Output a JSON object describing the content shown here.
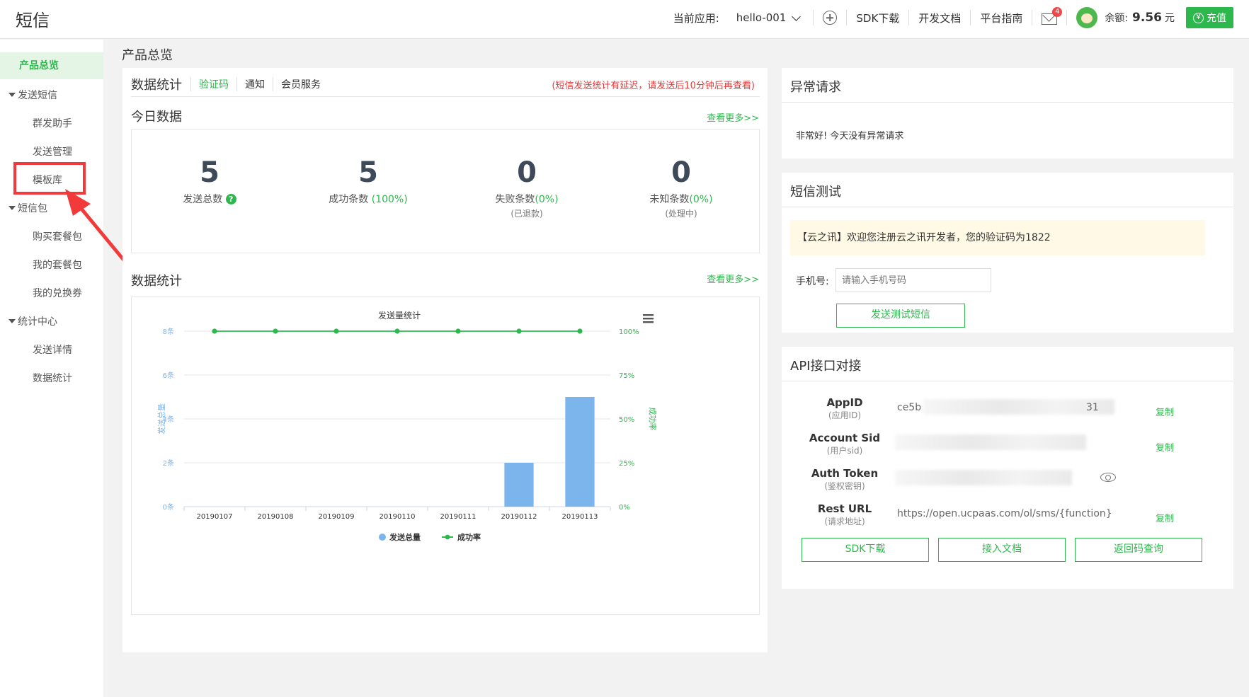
{
  "header": {
    "logo": "短信",
    "current_app_label": "当前应用:",
    "current_app": "hello-001",
    "sdk_download": "SDK下载",
    "dev_docs": "开发文档",
    "platform_guide": "平台指南",
    "mail_count": "4",
    "balance_label": "余额:",
    "balance_value": "9.56",
    "balance_unit": "元",
    "recharge": "充值",
    "recharge_symbol": "¥"
  },
  "sidebar": {
    "active": "产品总览",
    "groups": [
      {
        "label": "发送短信",
        "items": [
          "群发助手",
          "发送管理",
          "模板库"
        ]
      },
      {
        "label": "短信包",
        "items": [
          "购买套餐包",
          "我的套餐包",
          "我的兑换券"
        ]
      },
      {
        "label": "统计中心",
        "items": [
          "发送详情",
          "数据统计"
        ]
      }
    ]
  },
  "main": {
    "page_title": "产品总览",
    "stats_panel": {
      "title": "数据统计",
      "tabs": [
        "验证码",
        "通知",
        "会员服务"
      ],
      "active_tab": "验证码",
      "notice": "(短信发送统计有延迟，请发送后10分钟后再查看)",
      "today_title": "今日数据",
      "more": "查看更多>>",
      "stats": [
        {
          "num": "5",
          "label": "发送总数",
          "extra": "",
          "sub": ""
        },
        {
          "num": "5",
          "label": "成功条数",
          "extra": "(100%)",
          "sub": ""
        },
        {
          "num": "0",
          "label": "失败条数",
          "extra": "(0%)",
          "sub": "(已退款)"
        },
        {
          "num": "0",
          "label": "未知条数",
          "extra": "(0%)",
          "sub": "(处理中)"
        }
      ],
      "help_icon_glyph": "?",
      "chart_section_title": "数据统计",
      "chart_more": "查看更多>>"
    }
  },
  "chart_data": {
    "type": "bar",
    "title": "发送量统计",
    "categories": [
      "20190107",
      "20190108",
      "20190109",
      "20190110",
      "20190111",
      "20190112",
      "20190113"
    ],
    "series": [
      {
        "name": "发送总量",
        "type": "bar",
        "values": [
          0,
          0,
          0,
          0,
          0,
          2,
          5
        ],
        "color": "#7cb5ec"
      },
      {
        "name": "成功率",
        "type": "line",
        "values": [
          100,
          100,
          100,
          100,
          100,
          100,
          100
        ],
        "color": "#2db84d"
      }
    ],
    "ylabel": "发送总量",
    "y2label": "成功率",
    "yticks": [
      "0条",
      "2条",
      "4条",
      "6条",
      "8条"
    ],
    "y2ticks": [
      "0%",
      "25%",
      "50%",
      "75%",
      "100%"
    ],
    "ylim": [
      0,
      8
    ],
    "y2lim": [
      0,
      100
    ],
    "legend": "bottom-center",
    "grid": true
  },
  "right": {
    "abnormal": {
      "title": "异常请求",
      "message": "非常好! 今天没有异常请求"
    },
    "sms_test": {
      "title": "短信测试",
      "preview": "【云之讯】欢迎您注册云之讯开发者，您的验证码为1822",
      "phone_label": "手机号:",
      "phone_placeholder": "请输入手机号码",
      "send_button": "发送测试短信"
    },
    "api": {
      "title": "API接口对接",
      "rows": [
        {
          "key": "AppID",
          "sub": "(应用ID)",
          "value_start": "ce5b",
          "value_end": "31",
          "copy": "复制"
        },
        {
          "key": "Account Sid",
          "sub": "(用户sid)",
          "value_start": "",
          "value_end": "",
          "copy": "复制"
        },
        {
          "key": "Auth Token",
          "sub": "(鉴权密钥)",
          "value_start": "",
          "value_end": "",
          "copy": ""
        },
        {
          "key": "Rest URL",
          "sub": "(请求地址)",
          "value_start": "https://open.ucpaas.com/ol/sms/{function}",
          "value_end": "",
          "copy": "复制"
        }
      ],
      "buttons": [
        "SDK下载",
        "接入文档",
        "返回码查询"
      ]
    }
  }
}
